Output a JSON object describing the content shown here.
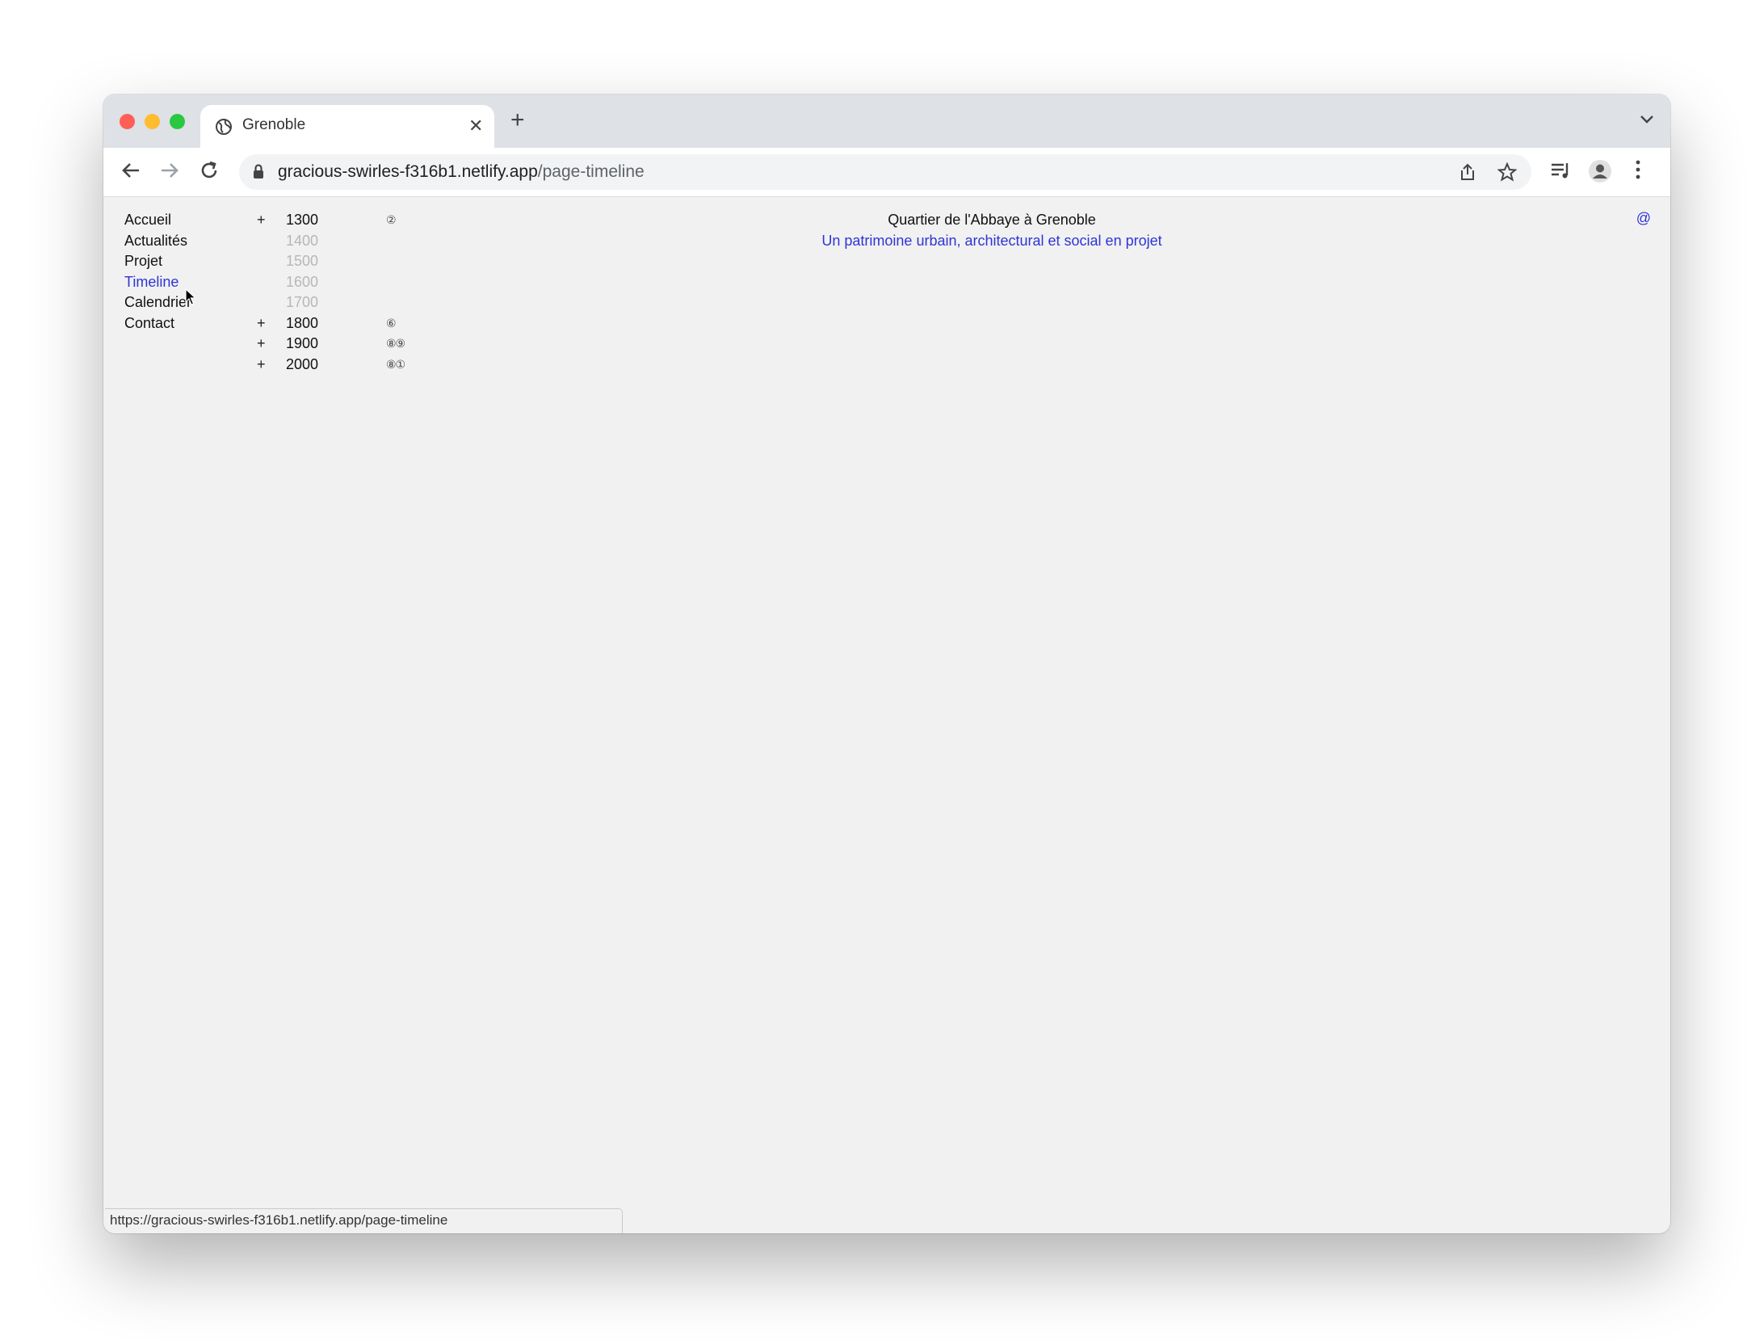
{
  "browser": {
    "tab_title": "Grenoble",
    "url_host": "gracious-swirles-f316b1.netlify.app",
    "url_path": "/page-timeline",
    "status_url": "https://gracious-swirles-f316b1.netlify.app/page-timeline",
    "new_tab_label": "+",
    "close_label": "✕"
  },
  "nav": {
    "items": [
      {
        "label": "Accueil",
        "active": false
      },
      {
        "label": "Actualités",
        "active": false
      },
      {
        "label": "Projet",
        "active": false
      },
      {
        "label": "Timeline",
        "active": true
      },
      {
        "label": "Calendrier",
        "active": false
      },
      {
        "label": "Contact",
        "active": false
      }
    ]
  },
  "timeline": {
    "rows": [
      {
        "plus": "+",
        "year": "1300",
        "marks": "②",
        "dim": false
      },
      {
        "plus": "",
        "year": "1400",
        "marks": "",
        "dim": true
      },
      {
        "plus": "",
        "year": "1500",
        "marks": "",
        "dim": true
      },
      {
        "plus": "",
        "year": "1600",
        "marks": "",
        "dim": true
      },
      {
        "plus": "",
        "year": "1700",
        "marks": "",
        "dim": true
      },
      {
        "plus": "+",
        "year": "1800",
        "marks": "⑥",
        "dim": false
      },
      {
        "plus": "+",
        "year": "1900",
        "marks": "⑧⑨",
        "dim": false
      },
      {
        "plus": "+",
        "year": "2000",
        "marks": "⑧①",
        "dim": false
      }
    ]
  },
  "header": {
    "title": "Quartier de l'Abbaye à Grenoble",
    "subtitle": "Un patrimoine urbain, architectural et social en projet",
    "contact_symbol": "@"
  },
  "colors": {
    "accent": "#2d35d6",
    "page_bg": "#f1f1f1",
    "dim_text": "#b7b7b7"
  }
}
